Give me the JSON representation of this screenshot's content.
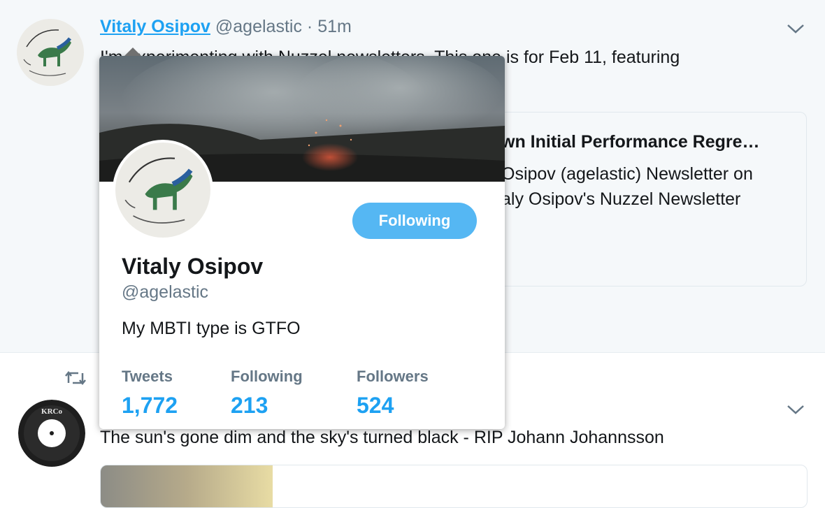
{
  "tweet1": {
    "name": "Vitaly Osipov",
    "handle": "@agelastic",
    "separator": "·",
    "time": "51m",
    "text": "I'm experimenting with Nuzzel newsletters. This one is for Feb 11, featuring",
    "card": {
      "title": "wn Initial Performance Regre…",
      "desc_line1": "Osipov (agelastic) Newsletter on",
      "desc_line2": "aly Osipov's Nuzzel Newsletter"
    }
  },
  "tweet2": {
    "text": "The sun's gone dim and the sky's turned black - RIP Johann Johannsson",
    "avatar_label": "KRCo"
  },
  "profile_card": {
    "name": "Vitaly Osipov",
    "handle": "@agelastic",
    "bio": "My MBTI type is GTFO",
    "follow_button": "Following",
    "stats": [
      {
        "label": "Tweets",
        "value": "1,772"
      },
      {
        "label": "Following",
        "value": "213"
      },
      {
        "label": "Followers",
        "value": "524"
      }
    ]
  },
  "icons": {
    "caret": "chevron-down-icon",
    "retweet": "retweet-icon"
  },
  "colors": {
    "accent": "#1da1f2",
    "button": "#55b7f3",
    "muted": "#657786",
    "background": "#f5f8fa"
  }
}
